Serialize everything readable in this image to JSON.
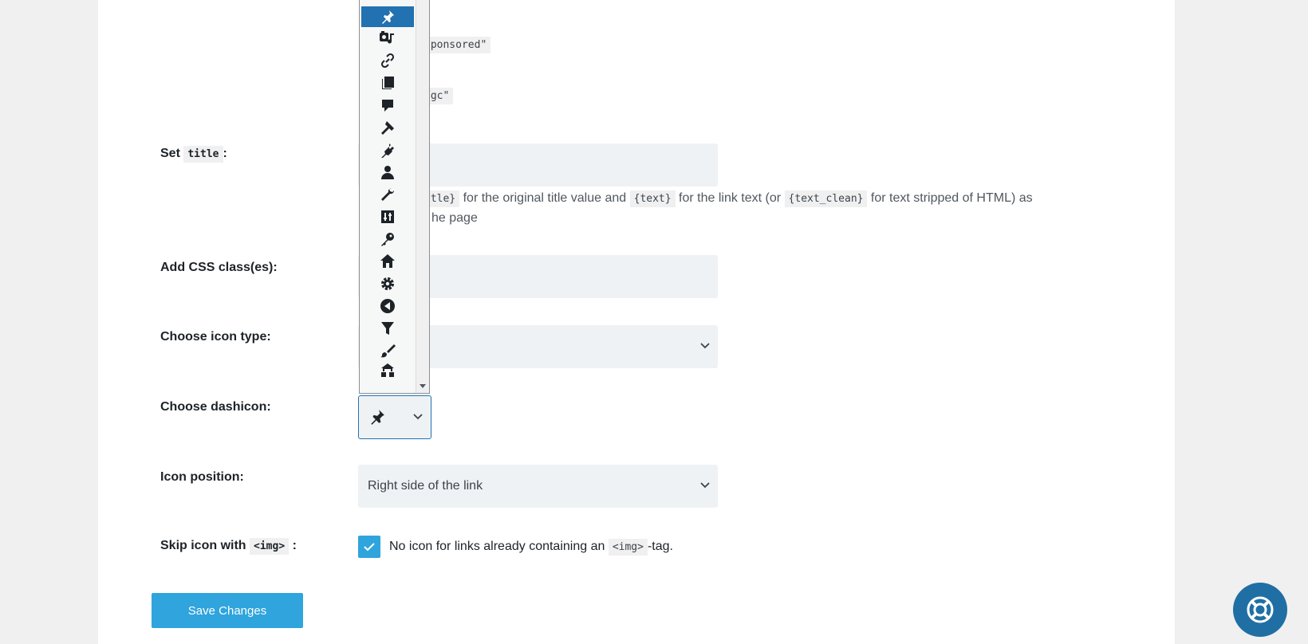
{
  "form": {
    "rel_sponsored_value": "sponsored\"",
    "rel_ugc_value": "ugc\"",
    "title": {
      "label_prefix": "Set",
      "label_code": "title",
      "label_suffix": ":",
      "help_code_1": "itle}",
      "help_text_1": "for the original title value and",
      "help_code_2": "{text}",
      "help_text_2": "for the link text (or",
      "help_code_3": "{text_clean}",
      "help_text_3": "for text stripped of HTML) as",
      "help_line2": "he page"
    },
    "css_class": {
      "label": "Add CSS class(es):"
    },
    "icon_type": {
      "label": "Choose icon type:"
    },
    "dashicon": {
      "label": "Choose dashicon:",
      "selected_icon": "pin-icon",
      "options": [
        "pin-icon",
        "format-audio-icon",
        "link-icon",
        "pages-icon",
        "comment-icon",
        "hammer-icon",
        "plugin-icon",
        "user-icon",
        "tools-icon",
        "sliders-icon",
        "key-icon",
        "home-icon",
        "gear-icon",
        "back-arrow-icon",
        "filter-icon",
        "paintbrush-icon",
        "networking-icon"
      ]
    },
    "icon_position": {
      "label": "Icon position:",
      "value": "Right side of the link"
    },
    "skip_img": {
      "label_prefix": "Skip icon with",
      "label_code": "<img>",
      "label_suffix": ":",
      "checked": true,
      "desc_prefix": "No icon for links already containing an",
      "desc_code": "<img>",
      "desc_suffix": "-tag."
    },
    "save_label": "Save Changes"
  },
  "colors": {
    "accent": "#2fa4dd",
    "help_button": "#1f6fa5",
    "selection": "#2271b1"
  }
}
